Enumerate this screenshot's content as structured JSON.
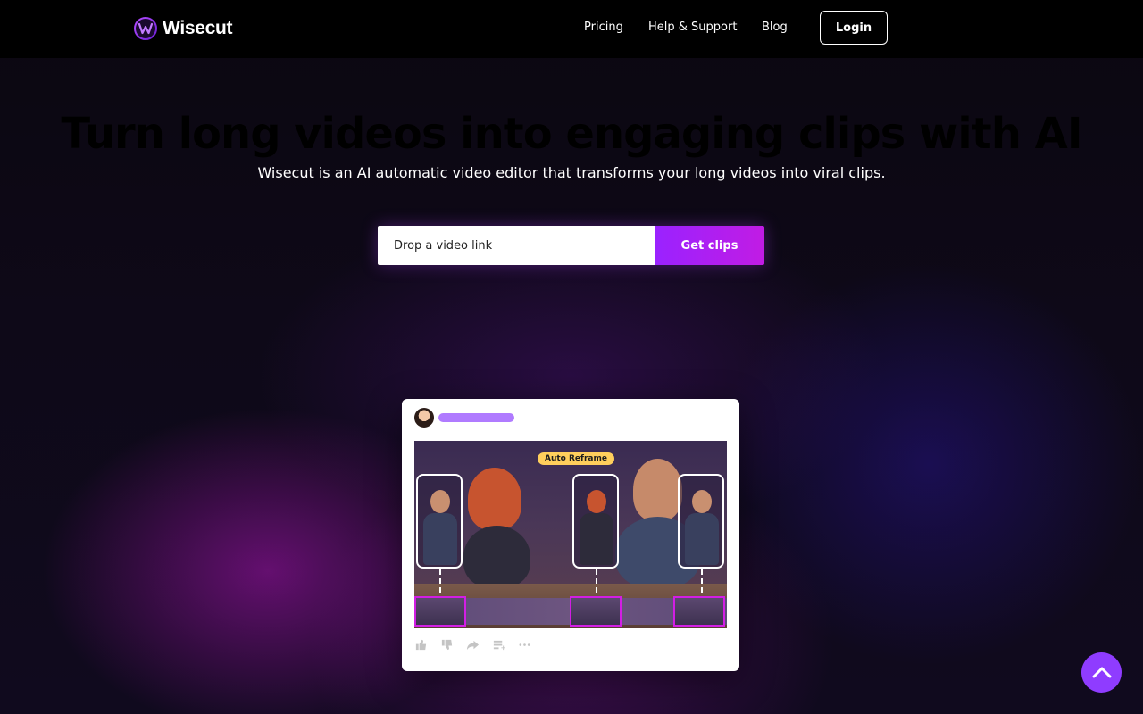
{
  "brand": {
    "name": "Wisecut",
    "accent": "#9a22ff",
    "accent_end": "#c11ce4"
  },
  "nav": {
    "links": [
      "Pricing",
      "Help & Support",
      "Blog"
    ],
    "login_label": "Login"
  },
  "hero": {
    "title": "Turn long videos into engaging clips with AI",
    "subtitle": "Wisecut is an AI automatic video editor that transforms your long videos into viral clips.",
    "input_placeholder": "Drop a video link",
    "button_label": "Get clips"
  },
  "preview": {
    "badge": "Auto Reframe",
    "action_icons": [
      "thumbs-up-icon",
      "thumbs-down-icon",
      "share-icon",
      "add-to-playlist-icon",
      "more-icon"
    ]
  },
  "scroll_top": {
    "icon": "chevron-up-icon"
  }
}
